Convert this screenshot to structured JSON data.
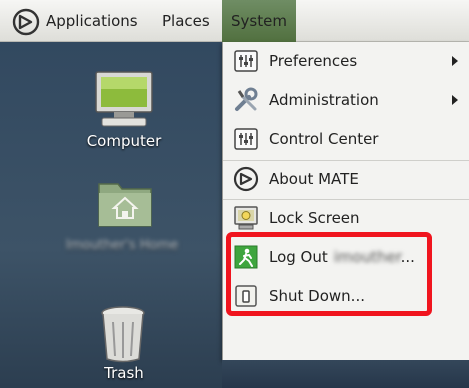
{
  "panel": {
    "logo_icon": "mate-logo-icon",
    "menus": [
      "Applications",
      "Places",
      "System"
    ],
    "active_menu": "System",
    "active_color": "#5d7b4d"
  },
  "desktop": {
    "icons": [
      {
        "label": "Computer",
        "icon": "computer-icon"
      },
      {
        "label": "Imouther's Home",
        "icon": "home-folder-icon",
        "obscured": true
      },
      {
        "label": "Trash",
        "icon": "trash-icon"
      }
    ]
  },
  "system_menu": {
    "items": [
      {
        "label": "Preferences",
        "icon": "preferences-icon",
        "submenu": true
      },
      {
        "label": "Administration",
        "icon": "administration-icon",
        "submenu": true
      },
      {
        "label": "Control Center",
        "icon": "control-center-icon",
        "submenu": false
      },
      {
        "label": "About MATE",
        "icon": "mate-logo-icon",
        "submenu": false
      },
      {
        "label": "Lock Screen",
        "icon": "lock-screen-icon",
        "submenu": false
      },
      {
        "label": "Log Out",
        "username_obscured": "imouther",
        "suffix": "...",
        "icon": "log-out-icon",
        "submenu": false
      },
      {
        "label": "Shut Down...",
        "icon": "shut-down-icon",
        "submenu": false
      }
    ],
    "highlight_color": "#f0141e"
  }
}
